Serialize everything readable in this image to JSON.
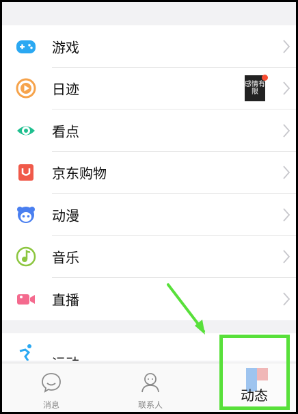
{
  "menu": {
    "items": [
      {
        "label": "游戏",
        "icon": "gamepad-icon",
        "color": "#2aa8f2"
      },
      {
        "label": "日迹",
        "icon": "play-circle-icon",
        "color": "#f6a34b",
        "thumbnail_text": "感情有限"
      },
      {
        "label": "看点",
        "icon": "eye-icon",
        "color": "#1fbf8f"
      },
      {
        "label": "京东购物",
        "icon": "shopping-bag-icon",
        "color": "#f05a4a"
      },
      {
        "label": "动漫",
        "icon": "anime-face-icon",
        "color": "#4a7ff0"
      },
      {
        "label": "音乐",
        "icon": "music-note-icon",
        "color": "#8cc63f"
      },
      {
        "label": "直播",
        "icon": "video-camera-icon",
        "color": "#f46a8e"
      }
    ],
    "partial_item": {
      "label": "运动",
      "icon": "running-icon",
      "color": "#2aa8f2"
    }
  },
  "tabbar": {
    "messages_label": "消息",
    "contacts_label": "联系人",
    "dongtai_label": "动态"
  },
  "colors": {
    "highlight": "#58e03a",
    "red_dot": "#f74c31"
  }
}
